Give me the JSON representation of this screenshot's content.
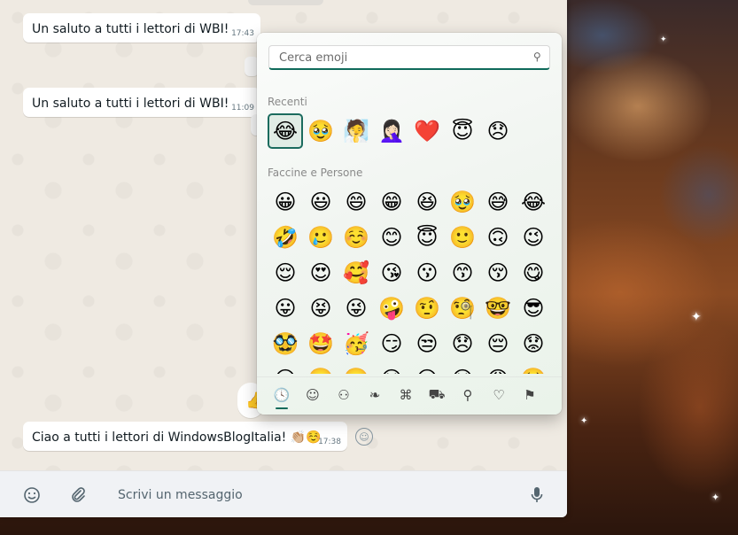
{
  "messages": [
    {
      "text": "Un saluto a tutti i lettori di WBI!",
      "time": "17:43"
    },
    {
      "text": "Un saluto a tutti i lettori di WBI!",
      "time": "11:09"
    },
    {
      "text": "Ciao a tutti i lettori di WindowsBlogItalia! 👏🏼☺️",
      "time": "17:38"
    }
  ],
  "composer": {
    "placeholder": "Scrivi un messaggio",
    "emoji_icon": "smiley-icon",
    "attach_icon": "paperclip-icon",
    "mic_icon": "microphone-icon"
  },
  "emoji_picker": {
    "search_placeholder": "Cerca emoji",
    "search_icon": "search-icon",
    "recent_title": "Recenti",
    "recent": [
      "😂",
      "🥹",
      "🧖",
      "🤦🏻‍♀️",
      "❤️",
      "😇",
      "😞"
    ],
    "selected_index": 0,
    "people_title": "Faccine e Persone",
    "people_rows": [
      [
        "😀",
        "😃",
        "😄",
        "😁",
        "😆",
        "🥹",
        "😅",
        "😂"
      ],
      [
        "🤣",
        "🥲",
        "☺️",
        "😊",
        "😇",
        "🙂",
        "🙃",
        "😉"
      ],
      [
        "😌",
        "😍",
        "🥰",
        "😘",
        "😗",
        "😙",
        "😚",
        "😋"
      ],
      [
        "😛",
        "😝",
        "😜",
        "🤪",
        "🤨",
        "🧐",
        "🤓",
        "😎"
      ],
      [
        "🥸",
        "🤩",
        "🥳",
        "😏",
        "😒",
        "😞",
        "😔",
        "😟"
      ],
      [
        "😕",
        "🙁",
        "☹️",
        "😣",
        "😖",
        "😫",
        "😩",
        "🥺"
      ]
    ],
    "tabs": [
      {
        "name": "recent-tab",
        "icon": "clock-icon",
        "glyph": "🕓",
        "active": true
      },
      {
        "name": "smileys-tab",
        "icon": "smiley-icon",
        "glyph": "☺",
        "active": false
      },
      {
        "name": "people-tab",
        "icon": "people-icon",
        "glyph": "⚇",
        "active": false
      },
      {
        "name": "nature-tab",
        "icon": "leaf-icon",
        "glyph": "❧",
        "active": false
      },
      {
        "name": "gaming-tab",
        "icon": "gamepad-icon",
        "glyph": "⌘",
        "active": false
      },
      {
        "name": "travel-tab",
        "icon": "car-icon",
        "glyph": "⛟",
        "active": false
      },
      {
        "name": "places-tab",
        "icon": "pin-icon",
        "glyph": "⚲",
        "active": false
      },
      {
        "name": "symbols-tab",
        "icon": "symbols-icon",
        "glyph": "♡",
        "active": false
      },
      {
        "name": "flags-tab",
        "icon": "flag-icon",
        "glyph": "⚑",
        "active": false
      }
    ]
  }
}
